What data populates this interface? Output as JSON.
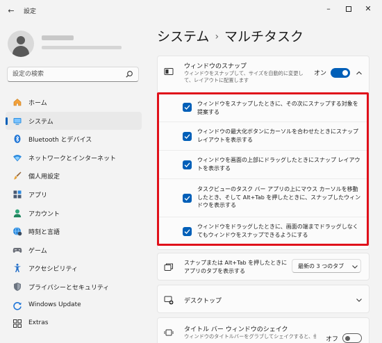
{
  "window": {
    "app_title": "設定",
    "back_glyph": "←",
    "min_glyph": "–",
    "close_glyph": "✕"
  },
  "search": {
    "placeholder": "設定の検索"
  },
  "nav": {
    "items": [
      {
        "label": "ホーム",
        "icon": "home-icon"
      },
      {
        "label": "システム",
        "icon": "system-icon"
      },
      {
        "label": "Bluetooth とデバイス",
        "icon": "bluetooth-icon"
      },
      {
        "label": "ネットワークとインターネット",
        "icon": "wifi-icon"
      },
      {
        "label": "個人用設定",
        "icon": "brush-icon"
      },
      {
        "label": "アプリ",
        "icon": "apps-icon"
      },
      {
        "label": "アカウント",
        "icon": "account-icon"
      },
      {
        "label": "時刻と言語",
        "icon": "globe-clock-icon"
      },
      {
        "label": "ゲーム",
        "icon": "gamepad-icon"
      },
      {
        "label": "アクセシビリティ",
        "icon": "accessibility-icon"
      },
      {
        "label": "プライバシーとセキュリティ",
        "icon": "shield-icon"
      },
      {
        "label": "Windows Update",
        "icon": "update-icon"
      },
      {
        "label": "Extras",
        "icon": "extras-icon"
      }
    ]
  },
  "page": {
    "breadcrumb_parent": "システム",
    "separator": "›",
    "title": "マルチタスク"
  },
  "snap": {
    "title": "ウィンドウのスナップ",
    "description": "ウィンドウをスナップして、サイズを自動的に変更して、レイアウトに配置します",
    "toggle_label": "オン",
    "toggle_state": "on",
    "options": [
      {
        "text": "ウィンドウをスナップしたときに、その次にスナップする対象を提案する",
        "checked": true
      },
      {
        "text": "ウィンドウの最大化ボタンにカーソルを合わせたときにスナップ レイアウトを表示する",
        "checked": true
      },
      {
        "text": "ウィンドウを画面の上部にドラッグしたときにスナップ レイアウトを表示する",
        "checked": true
      },
      {
        "text": "タスクビューのタスク バー アプリの上にマウス カーソルを移動したとき、そして Alt+Tab を押したときに、スナップしたウィンドウを表示する",
        "checked": true
      },
      {
        "text": "ウィンドウをドラッグしたときに、画面の端までドラッグしなくてもウィンドウをスナップできるようにする",
        "checked": true
      }
    ]
  },
  "alt_tab": {
    "label": "スナップまたは Alt+Tab を押したときにアプリのタブを表示する",
    "dropdown_value": "最新の 3 つのタブ"
  },
  "desktops": {
    "title": "デスクトップ"
  },
  "shake": {
    "title": "タイトル バー ウィンドウのシェイク",
    "description": "ウィンドウのタイトルバーをグラブしてシェイクすると、他のすべて",
    "toggle_label": "オフ",
    "toggle_state": "off"
  },
  "colors": {
    "accent": "#005fb8",
    "highlight_border": "#e0101a"
  }
}
